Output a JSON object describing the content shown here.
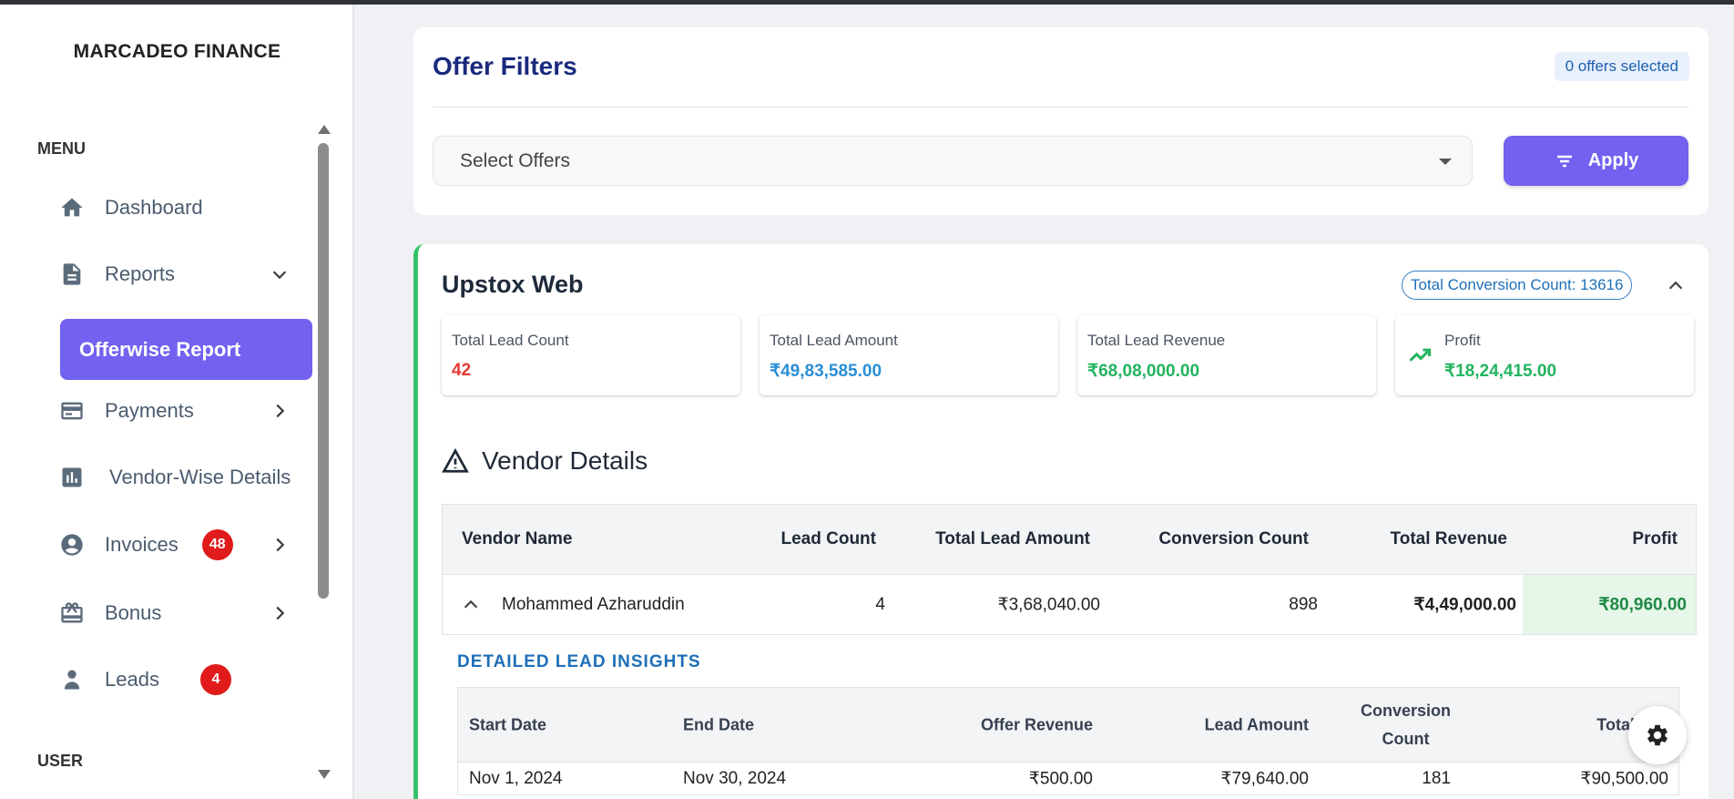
{
  "sidebar": {
    "brand": "MARCADEO FINANCE",
    "menu_label": "MENU",
    "user_label": "USER",
    "items": [
      {
        "label": "Dashboard",
        "icon": "home-icon"
      },
      {
        "label": "Reports",
        "icon": "document-icon",
        "expanded": true
      },
      {
        "label": "Offerwise Report",
        "active": true
      },
      {
        "label": "Payments",
        "icon": "credit-card-icon"
      },
      {
        "label": "Vendor-Wise Details",
        "icon": "bar-chart-icon"
      },
      {
        "label": "Invoices",
        "icon": "account-circle-icon",
        "badge": "48"
      },
      {
        "label": "Bonus",
        "icon": "gift-icon"
      },
      {
        "label": "Leads",
        "icon": "person-icon",
        "badge": "4"
      }
    ]
  },
  "filters": {
    "title": "Offer Filters",
    "selected_count": "0 offers selected",
    "select_placeholder": "Select Offers",
    "apply_label": "Apply"
  },
  "offer": {
    "name": "Upstox Web",
    "conversion_chip": "Total Conversion Count: 13616",
    "stats": [
      {
        "label": "Total Lead Count",
        "value": "42",
        "color": "#e53935"
      },
      {
        "label": "Total Lead Amount",
        "value": "₹49,83,585.00",
        "color": "#2b8fd6"
      },
      {
        "label": "Total Lead Revenue",
        "value": "₹68,08,000.00",
        "color": "#22b45e"
      },
      {
        "label": "Profit",
        "value": "₹18,24,415.00",
        "color": "#22b45e"
      }
    ]
  },
  "vendor_section": {
    "title": "Vendor Details",
    "columns": [
      "Vendor Name",
      "Lead Count",
      "Total Lead Amount",
      "Conversion Count",
      "Total Revenue",
      "Profit"
    ],
    "rows": [
      {
        "name": "Mohammed Azharuddin",
        "lead_count": "4",
        "lead_amount": "₹3,68,040.00",
        "conversion_count": "898",
        "revenue": "₹4,49,000.00",
        "profit": "₹80,960.00"
      }
    ]
  },
  "insights": {
    "title": "DETAILED LEAD INSIGHTS",
    "columns": [
      "Start Date",
      "End Date",
      "Offer Revenue",
      "Lead Amount",
      "Conversion",
      "Count",
      "Total Reve"
    ],
    "rows": [
      {
        "start": "Nov 1, 2024",
        "end": "Nov 30, 2024",
        "offer_revenue": "₹500.00",
        "lead_amount": "₹79,640.00",
        "conversion_count": "181",
        "total_revenue": "₹90,500.00"
      }
    ]
  },
  "colors": {
    "accent": "#7361f0",
    "success": "#22b45e",
    "danger": "#e11b1b",
    "link": "#1e6fb8"
  }
}
